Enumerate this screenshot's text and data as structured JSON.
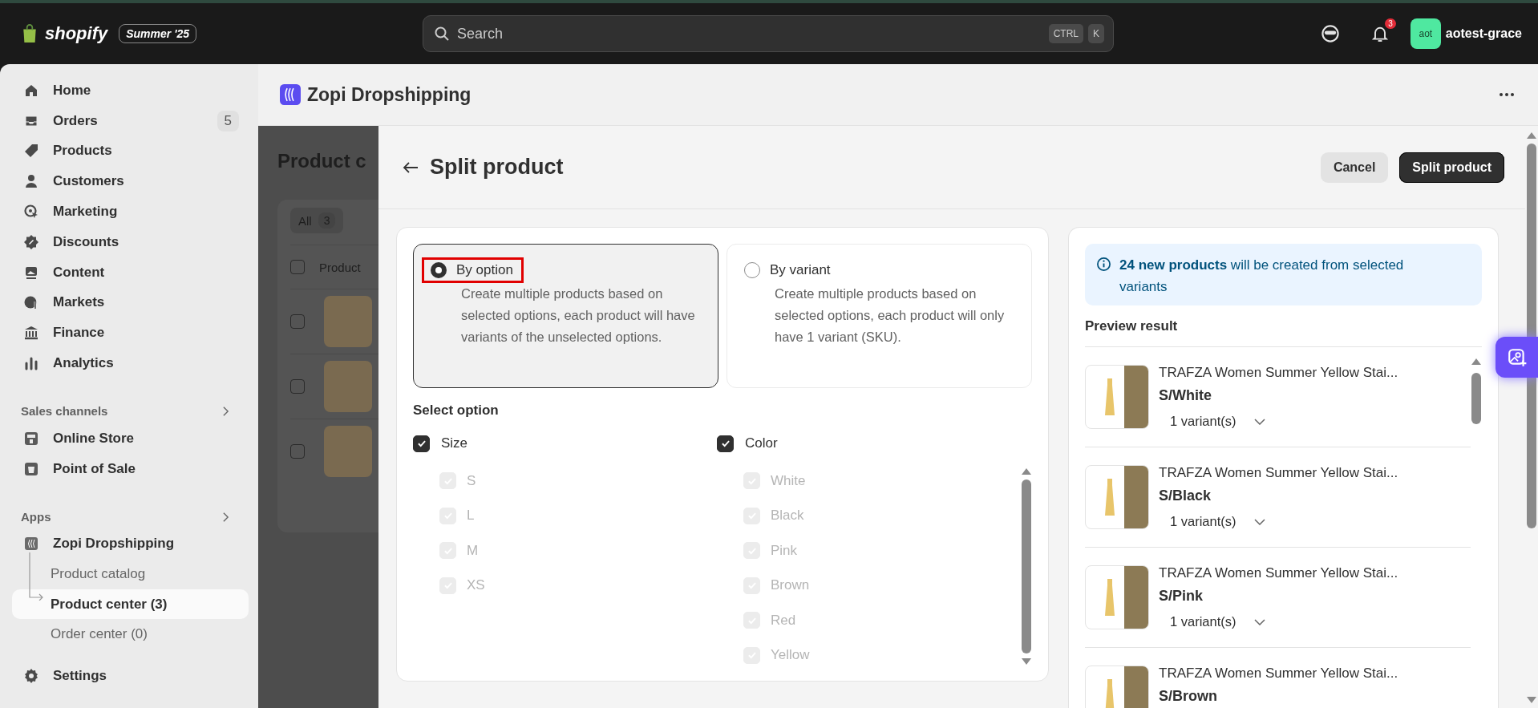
{
  "topbar": {
    "logo": "shopify",
    "edition": "Summer '25",
    "search": {
      "placeholder": "Search",
      "keys": [
        "CTRL",
        "K"
      ]
    },
    "notifications": "3",
    "avatar": "aot",
    "user": "aotest-grace"
  },
  "sidebar": {
    "items": [
      {
        "label": "Home",
        "selected": false
      },
      {
        "label": "Orders",
        "badge": "5",
        "selected": false
      },
      {
        "label": "Products",
        "selected": false
      },
      {
        "label": "Customers",
        "selected": false
      },
      {
        "label": "Marketing",
        "selected": false
      },
      {
        "label": "Discounts",
        "selected": false
      },
      {
        "label": "Content",
        "selected": false
      },
      {
        "label": "Markets",
        "selected": false
      },
      {
        "label": "Finance",
        "selected": false
      },
      {
        "label": "Analytics",
        "selected": false
      }
    ],
    "sales_channels": {
      "title": "Sales channels",
      "items": [
        {
          "label": "Online Store",
          "selected": false
        },
        {
          "label": "Point of Sale",
          "selected": false
        }
      ]
    },
    "apps": {
      "title": "Apps",
      "app": {
        "label": "Zopi Dropshipping",
        "children": [
          {
            "label": "Product catalog",
            "selected": false
          },
          {
            "label": "Product center (3)",
            "selected": true
          },
          {
            "label": "Order center (0)",
            "selected": false
          }
        ]
      }
    },
    "settings": "Settings"
  },
  "app_header": {
    "title": "Zopi Dropshipping"
  },
  "background_page": {
    "title": "Product c",
    "tab": {
      "label": "All",
      "count": "3"
    },
    "column": "Product",
    "header_checked": false,
    "rows": [
      {
        "checked": false
      },
      {
        "checked": false
      },
      {
        "checked": false
      }
    ]
  },
  "modal": {
    "title": "Split product",
    "buttons": [
      {
        "label": "Cancel",
        "kind": "secondary"
      },
      {
        "label": "Split product",
        "kind": "primary"
      }
    ],
    "modes": [
      {
        "label": "By option",
        "description": "Create multiple products based on selected options, each product will have variants of the unselected options.",
        "selected": true,
        "highlighted": true
      },
      {
        "label": "By variant",
        "description": "Create multiple products based on selected options, each product will only have 1 variant (SKU).",
        "selected": false,
        "highlighted": false
      }
    ],
    "select_option_title": "Select option",
    "option_groups": [
      {
        "name": "Size",
        "checked": true,
        "values": [
          {
            "label": "S",
            "checked": true,
            "disabled": true
          },
          {
            "label": "L",
            "checked": true,
            "disabled": true
          },
          {
            "label": "M",
            "checked": true,
            "disabled": true
          },
          {
            "label": "XS",
            "checked": true,
            "disabled": true
          }
        ]
      },
      {
        "name": "Color",
        "checked": true,
        "values": [
          {
            "label": "White",
            "checked": true,
            "disabled": true
          },
          {
            "label": "Black",
            "checked": true,
            "disabled": true
          },
          {
            "label": "Pink",
            "checked": true,
            "disabled": true
          },
          {
            "label": "Brown",
            "checked": true,
            "disabled": true
          },
          {
            "label": "Red",
            "checked": true,
            "disabled": true
          },
          {
            "label": "Yellow",
            "checked": true,
            "disabled": true
          }
        ]
      }
    ],
    "banner": "**24 new products** will be created from selected variants",
    "preview_title": "Preview result",
    "preview": [
      {
        "title": "TRAFZA Women Summer Yellow Stai...",
        "variant": "S/White",
        "count": "1 variant(s)"
      },
      {
        "title": "TRAFZA Women Summer Yellow Stai...",
        "variant": "S/Black",
        "count": "1 variant(s)"
      },
      {
        "title": "TRAFZA Women Summer Yellow Stai...",
        "variant": "S/Pink",
        "count": "1 variant(s)"
      },
      {
        "title": "TRAFZA Women Summer Yellow Stai...",
        "variant": "S/Brown"
      }
    ]
  }
}
